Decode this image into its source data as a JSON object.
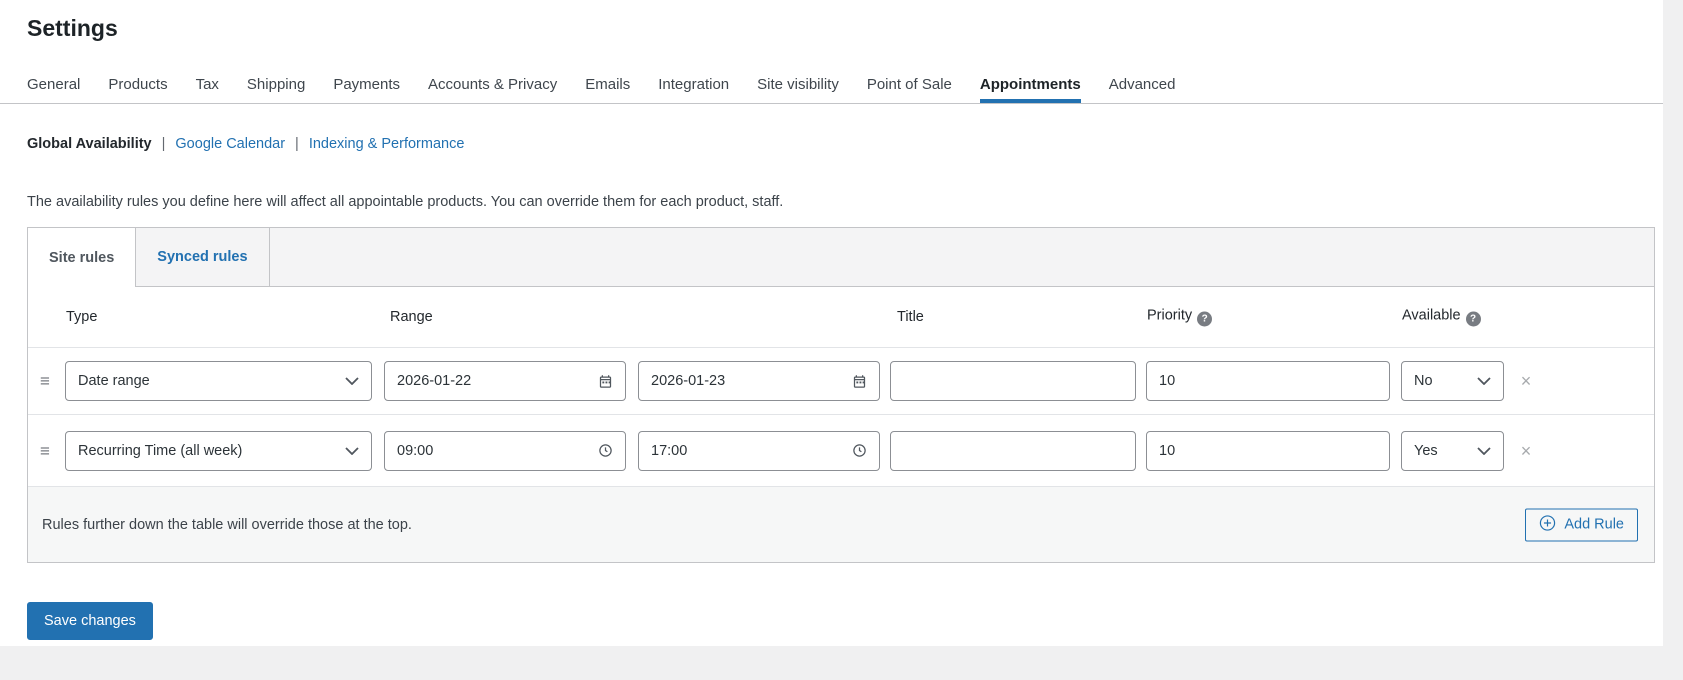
{
  "page": {
    "title": "Settings",
    "save_button": "Save changes"
  },
  "nav": {
    "tabs": [
      {
        "label": "General",
        "active": false
      },
      {
        "label": "Products",
        "active": false
      },
      {
        "label": "Tax",
        "active": false
      },
      {
        "label": "Shipping",
        "active": false
      },
      {
        "label": "Payments",
        "active": false
      },
      {
        "label": "Accounts & Privacy",
        "active": false
      },
      {
        "label": "Emails",
        "active": false
      },
      {
        "label": "Integration",
        "active": false
      },
      {
        "label": "Site visibility",
        "active": false
      },
      {
        "label": "Point of Sale",
        "active": false
      },
      {
        "label": "Appointments",
        "active": true
      },
      {
        "label": "Advanced",
        "active": false
      }
    ]
  },
  "subnav": {
    "separator": "|",
    "items": [
      {
        "label": "Global Availability",
        "active": true
      },
      {
        "label": "Google Calendar",
        "active": false
      },
      {
        "label": "Indexing & Performance",
        "active": false
      }
    ]
  },
  "intro": "The availability rules you define here will affect all appointable products. You can override them for each product, staff.",
  "availability": {
    "tabs": [
      {
        "label": "Site rules",
        "active": true
      },
      {
        "label": "Synced rules",
        "active": false
      }
    ],
    "columns": {
      "type": "Type",
      "range": "Range",
      "title": "Title",
      "priority": "Priority",
      "available": "Available"
    },
    "rows": [
      {
        "type": "Date range",
        "range_kind": "date",
        "range_from": "2026-01-22",
        "range_to": "2026-01-23",
        "title": "",
        "priority": "10",
        "available": "No"
      },
      {
        "type": "Recurring Time (all week)",
        "range_kind": "time",
        "range_from": "09:00",
        "range_to": "17:00",
        "title": "",
        "priority": "10",
        "available": "Yes"
      }
    ],
    "footer_note": "Rules further down the table will override those at the top.",
    "add_rule_label": "Add Rule"
  },
  "icons": {
    "drag_handle": "≡",
    "remove": "×",
    "help": "?"
  },
  "colors": {
    "accent": "#2271b1",
    "heading": "#1d2327",
    "box_border": "#c3c4c7",
    "input_border": "#8c8f94",
    "tabbar_bg": "#f4f4f5",
    "footer_bg": "#f6f7f7",
    "page_bg": "#f0f0f1"
  }
}
